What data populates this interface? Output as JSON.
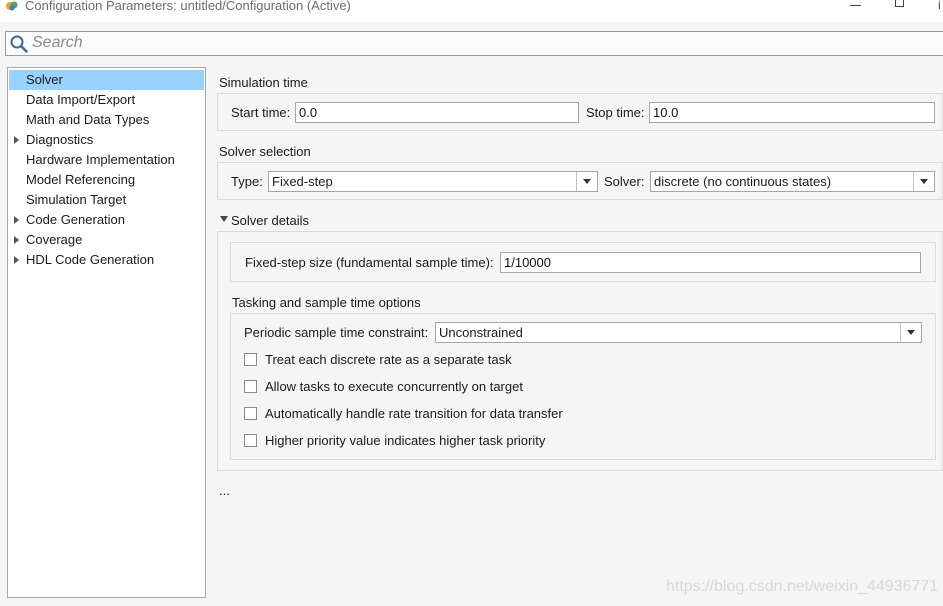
{
  "window": {
    "title": "Configuration Parameters: untitled/Configuration (Active)",
    "close_fragment": "i"
  },
  "search": {
    "placeholder": "Search",
    "value": ""
  },
  "sidebar": {
    "items": [
      {
        "label": "Solver",
        "selected": true,
        "expandable": false
      },
      {
        "label": "Data Import/Export",
        "selected": false,
        "expandable": false
      },
      {
        "label": "Math and Data Types",
        "selected": false,
        "expandable": false
      },
      {
        "label": "Diagnostics",
        "selected": false,
        "expandable": true
      },
      {
        "label": "Hardware Implementation",
        "selected": false,
        "expandable": false
      },
      {
        "label": "Model Referencing",
        "selected": false,
        "expandable": false
      },
      {
        "label": "Simulation Target",
        "selected": false,
        "expandable": false
      },
      {
        "label": "Code Generation",
        "selected": false,
        "expandable": true
      },
      {
        "label": "Coverage",
        "selected": false,
        "expandable": true
      },
      {
        "label": "HDL Code Generation",
        "selected": false,
        "expandable": true
      }
    ]
  },
  "simulation_time": {
    "title": "Simulation time",
    "start_label": "Start time:",
    "start_value": "0.0",
    "stop_label": "Stop time:",
    "stop_value": "10.0"
  },
  "solver_selection": {
    "title": "Solver selection",
    "type_label": "Type:",
    "type_value": "Fixed-step",
    "solver_label": "Solver:",
    "solver_value": "discrete (no continuous states)"
  },
  "solver_details": {
    "title": "Solver details",
    "expanded": true,
    "step_size_label": "Fixed-step size (fundamental sample time):",
    "step_size_value": "1/10000"
  },
  "tasking": {
    "title": "Tasking and sample time options",
    "constraint_label": "Periodic sample time constraint:",
    "constraint_value": "Unconstrained",
    "checkboxes": [
      {
        "label": "Treat each discrete rate as a separate task",
        "checked": false
      },
      {
        "label": "Allow tasks to execute concurrently on target",
        "checked": false
      },
      {
        "label": "Automatically handle rate transition for data transfer",
        "checked": false
      },
      {
        "label": "Higher priority value indicates higher task priority",
        "checked": false
      }
    ]
  },
  "more_indicator": "...",
  "watermark": "https://blog.csdn.net/weixin_44936771",
  "colors": {
    "selection": "#99d1ff",
    "background": "#f5f5f5",
    "panel_border": "#dadada"
  }
}
